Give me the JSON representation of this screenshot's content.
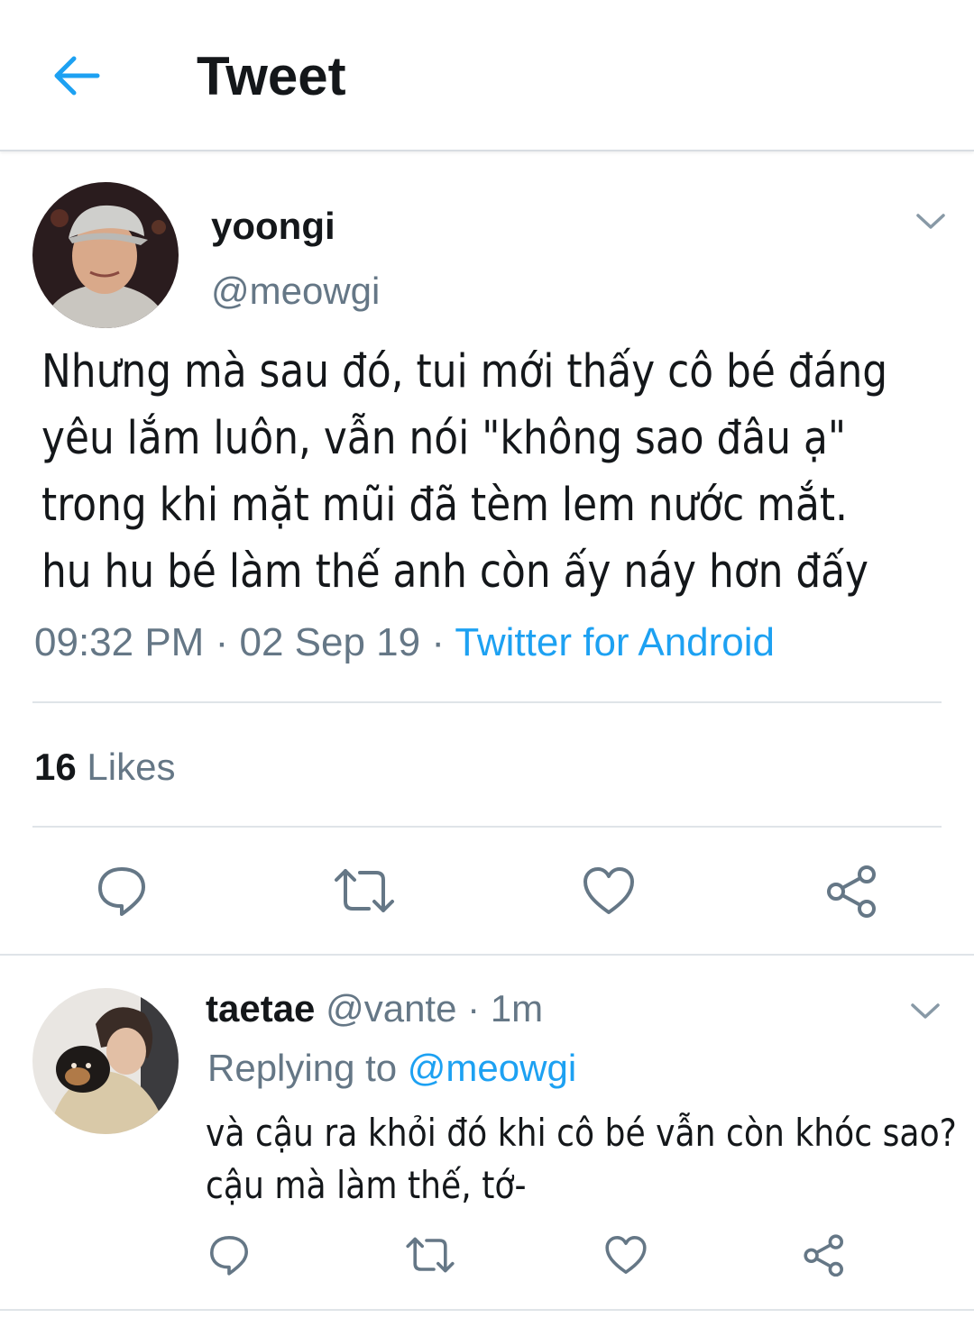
{
  "header": {
    "title": "Tweet",
    "back_icon": "arrow-left-icon",
    "accent_color": "#1da1f2"
  },
  "tweet": {
    "display_name": "yoongi",
    "handle": "@meowgi",
    "text_lines": [
      "Nhưng mà sau đó, tui mới thấy cô bé đáng",
      "yêu lắm luôn, vẫn nói \"không sao đâu ạ\"",
      "trong khi mặt mũi đã tèm lem nước mắt.",
      "hu hu bé làm thế anh còn ấy náy hơn đấy"
    ],
    "time": "09:32 PM",
    "date": "02 Sep 19",
    "separator": "·",
    "source": "Twitter for Android",
    "likes_count": "16",
    "likes_label": "Likes",
    "actions": [
      "reply-icon",
      "retweet-icon",
      "like-icon",
      "share-icon"
    ]
  },
  "reply": {
    "display_name": "taetae",
    "handle": "@vante",
    "separator": "·",
    "time": "1m",
    "replying_label": "Replying to",
    "replying_handle": "@meowgi",
    "text_lines": [
      "và cậu ra khỏi đó khi cô bé vẫn còn khóc sao?",
      "cậu mà làm thế, tớ-"
    ],
    "actions": [
      "reply-icon",
      "retweet-icon",
      "like-icon",
      "share-icon"
    ]
  },
  "colors": {
    "text": "#14171a",
    "secondary": "#657786",
    "link": "#1da1f2",
    "divider": "#dfe4e8"
  }
}
